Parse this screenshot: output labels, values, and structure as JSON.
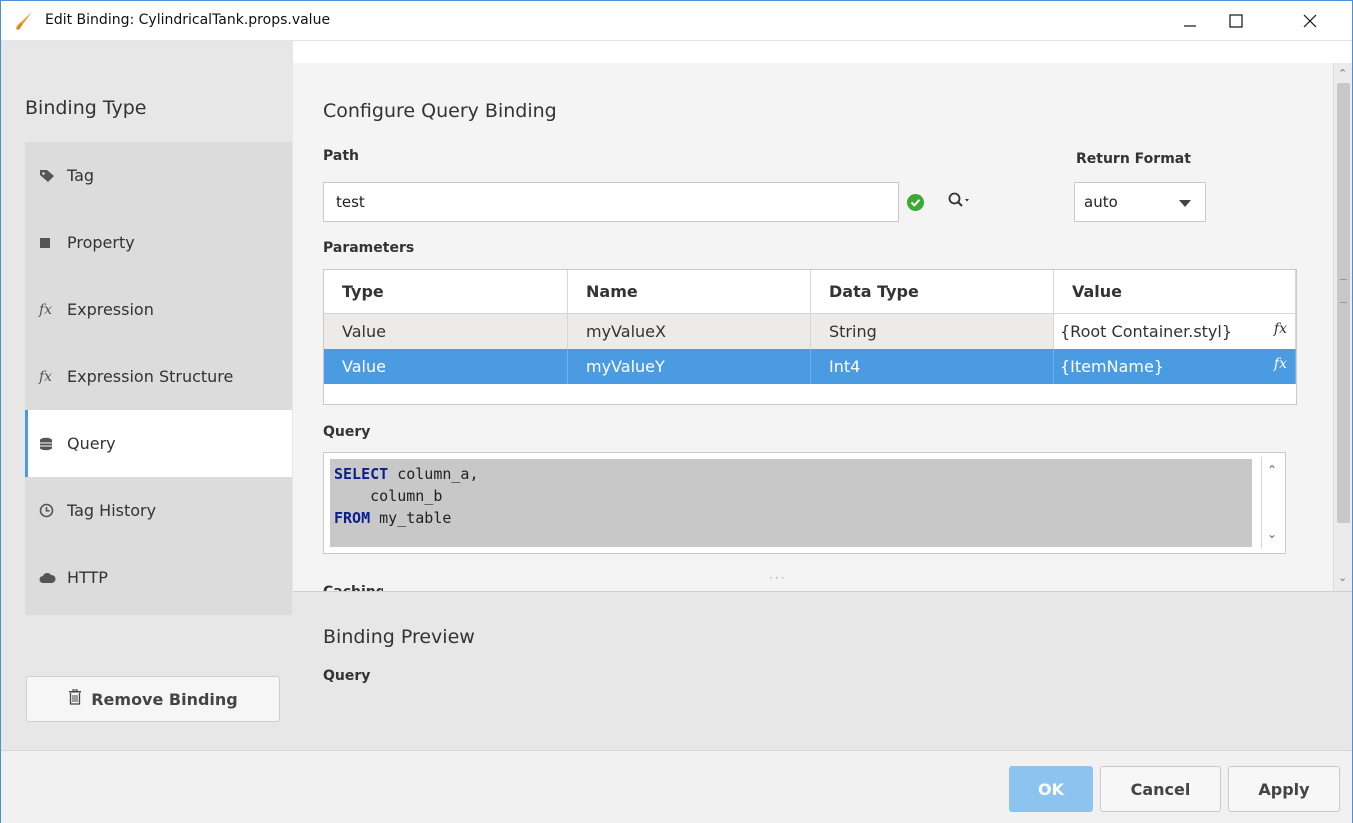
{
  "window": {
    "title": "Edit Binding: CylindricalTank.props.value",
    "controls": {
      "minimize": "minimize-icon",
      "maximize": "maximize-icon",
      "close": "close-icon"
    }
  },
  "sidebar": {
    "heading": "Binding Type",
    "items": [
      {
        "label": "Tag",
        "icon": "tag-icon"
      },
      {
        "label": "Property",
        "icon": "square-icon"
      },
      {
        "label": "Expression",
        "icon": "fx-icon"
      },
      {
        "label": "Expression Structure",
        "icon": "fx-icon"
      },
      {
        "label": "Query",
        "icon": "database-icon",
        "active": true
      },
      {
        "label": "Tag History",
        "icon": "clock-icon"
      },
      {
        "label": "HTTP",
        "icon": "cloud-icon"
      }
    ],
    "remove_binding": "Remove Binding"
  },
  "config": {
    "title": "Configure Query Binding",
    "path_label": "Path",
    "path_value": "test",
    "return_format_label": "Return Format",
    "return_format_value": "auto",
    "parameters_label": "Parameters",
    "params_columns": [
      "Type",
      "Name",
      "Data Type",
      "Value"
    ],
    "params_rows": [
      {
        "type": "Value",
        "name": "myValueX",
        "data_type": "String",
        "value": "{Root Container.styl}"
      },
      {
        "type": "Value",
        "name": "myValueY",
        "data_type": "Int4",
        "value": "{ItemName}",
        "selected": true
      }
    ],
    "query_label": "Query",
    "query_lines": [
      {
        "kw": "SELECT",
        "text": " column_a,"
      },
      {
        "kw": "",
        "text": "    column_b"
      },
      {
        "kw": "FROM",
        "text": " my_table"
      }
    ],
    "fx_glyph": "fx",
    "splitter": "···",
    "cut_label": "Caching"
  },
  "preview": {
    "title": "Binding Preview",
    "query_label": "Query"
  },
  "footer": {
    "ok": "OK",
    "cancel": "Cancel",
    "apply": "Apply"
  },
  "colors": {
    "accent": "#4a9be2",
    "ok_disabled": "#8cc4ef",
    "sidebar_bg": "#e7e7e7",
    "check_green": "#3aaa35",
    "sql_keyword": "#0a1f8f"
  }
}
